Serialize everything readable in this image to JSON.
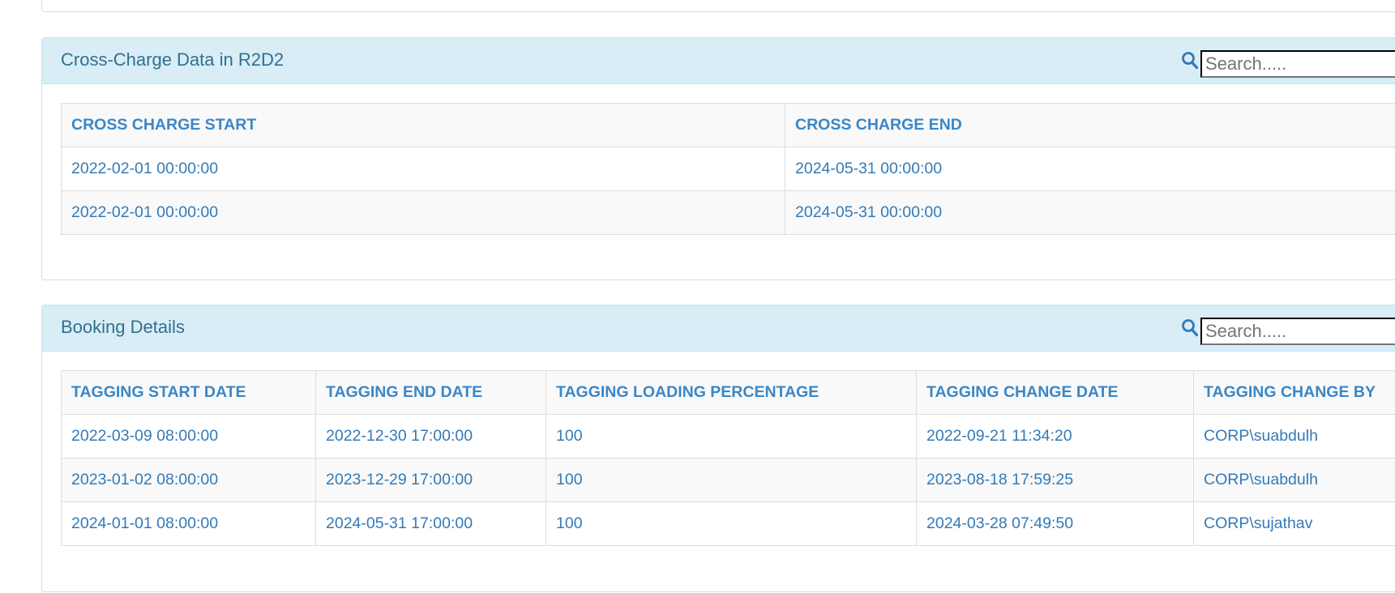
{
  "cross_charge": {
    "title": "Cross-Charge Data in R2D2",
    "search_placeholder": "Search.....",
    "columns": [
      "CROSS CHARGE START",
      "CROSS CHARGE END"
    ],
    "rows": [
      [
        "2022-02-01 00:00:00",
        "2024-05-31 00:00:00"
      ],
      [
        "2022-02-01 00:00:00",
        "2024-05-31 00:00:00"
      ]
    ]
  },
  "booking": {
    "title": "Booking Details",
    "search_placeholder": "Search.....",
    "columns": [
      "TAGGING START DATE",
      "TAGGING END DATE",
      "TAGGING LOADING PERCENTAGE",
      "TAGGING CHANGE DATE",
      "TAGGING CHANGE BY"
    ],
    "rows": [
      [
        "2022-03-09 08:00:00",
        "2022-12-30 17:00:00",
        "100",
        "2022-09-21 11:34:20",
        "CORP\\suabdulh"
      ],
      [
        "2023-01-02 08:00:00",
        "2023-12-29 17:00:00",
        "100",
        "2023-08-18 17:59:25",
        "CORP\\suabdulh"
      ],
      [
        "2024-01-01 08:00:00",
        "2024-05-31 17:00:00",
        "100",
        "2024-03-28 07:49:50",
        "CORP\\sujathav"
      ]
    ]
  },
  "colors": {
    "heading_bg": "#d9edf7",
    "heading_border": "#bce8f1",
    "title_text": "#31708f",
    "link_text": "#337ab7"
  },
  "icons": {
    "search": "search-icon"
  }
}
